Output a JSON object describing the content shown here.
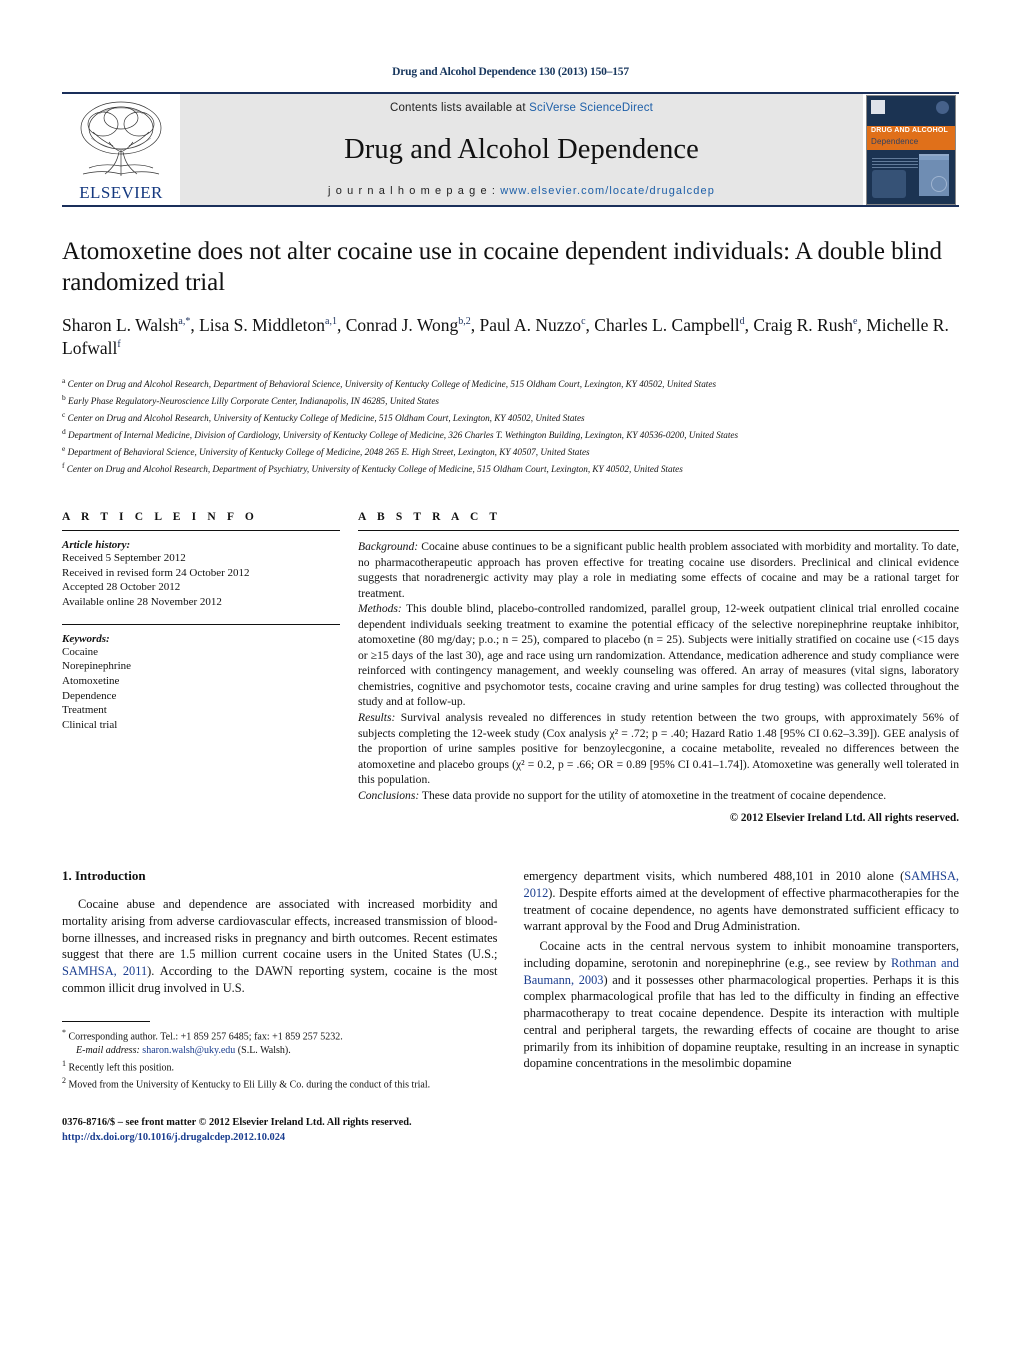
{
  "running_head": "Drug and Alcohol Dependence 130 (2013) 150–157",
  "masthead": {
    "contents_prefix": "Contents lists available at ",
    "contents_link": "SciVerse ScienceDirect",
    "journal_title": "Drug and Alcohol Dependence",
    "homepage_prefix": "j o u r n a l   h o m e p a g e :   ",
    "homepage_url": "www.elsevier.com/locate/drugalcdep",
    "publisher": "ELSEVIER",
    "cover": {
      "line1": "DRUG AND ALCOHOL",
      "line2": "Dependence"
    }
  },
  "article": {
    "title": "Atomoxetine does not alter cocaine use in cocaine dependent individuals: A double blind randomized trial",
    "authors_html": "Sharon L. Walsh<sup>a,*</sup>, Lisa S. Middleton<sup>a,1</sup>, Conrad J. Wong<sup>b,2</sup>, Paul A. Nuzzo<sup>c</sup>, Charles L. Campbell<sup>d</sup>, Craig R. Rush<sup>e</sup>, Michelle R. Lofwall<sup>f</sup>",
    "affiliations": [
      {
        "marker": "a",
        "text": "Center on Drug and Alcohol Research, Department of Behavioral Science, University of Kentucky College of Medicine, 515 Oldham Court, Lexington, KY 40502, United States"
      },
      {
        "marker": "b",
        "text": "Early Phase Regulatory-Neuroscience Lilly Corporate Center, Indianapolis, IN 46285, United States"
      },
      {
        "marker": "c",
        "text": "Center on Drug and Alcohol Research, University of Kentucky College of Medicine, 515 Oldham Court, Lexington, KY 40502, United States"
      },
      {
        "marker": "d",
        "text": "Department of Internal Medicine, Division of Cardiology, University of Kentucky College of Medicine, 326 Charles T. Wethington Building, Lexington, KY 40536-0200, United States"
      },
      {
        "marker": "e",
        "text": "Department of Behavioral Science, University of Kentucky College of Medicine, 2048 265 E. High Street, Lexington, KY 40507, United States"
      },
      {
        "marker": "f",
        "text": "Center on Drug and Alcohol Research, Department of Psychiatry, University of Kentucky College of Medicine, 515 Oldham Court, Lexington, KY 40502, United States"
      }
    ]
  },
  "article_info": {
    "heading": "A R T I C L E   I N F O",
    "history_label": "Article history:",
    "history": [
      "Received 5 September 2012",
      "Received in revised form 24 October 2012",
      "Accepted 28 October 2012",
      "Available online 28 November 2012"
    ],
    "keywords_label": "Keywords:",
    "keywords": [
      "Cocaine",
      "Norepinephrine",
      "Atomoxetine",
      "Dependence",
      "Treatment",
      "Clinical trial"
    ]
  },
  "abstract": {
    "heading": "A B S T R A C T",
    "sections": [
      {
        "label": "Background:",
        "text": " Cocaine abuse continues to be a significant public health problem associated with morbidity and mortality. To date, no pharmacotherapeutic approach has proven effective for treating cocaine use disorders. Preclinical and clinical evidence suggests that noradrenergic activity may play a role in mediating some effects of cocaine and may be a rational target for treatment."
      },
      {
        "label": "Methods:",
        "text": " This double blind, placebo-controlled randomized, parallel group, 12-week outpatient clinical trial enrolled cocaine dependent individuals seeking treatment to examine the potential efficacy of the selective norepinephrine reuptake inhibitor, atomoxetine (80 mg/day; p.o.; n = 25), compared to placebo (n = 25). Subjects were initially stratified on cocaine use (<15 days or ≥15 days of the last 30), age and race using urn randomization. Attendance, medication adherence and study compliance were reinforced with contingency management, and weekly counseling was offered. An array of measures (vital signs, laboratory chemistries, cognitive and psychomotor tests, cocaine craving and urine samples for drug testing) was collected throughout the study and at follow-up."
      },
      {
        "label": "Results:",
        "text": " Survival analysis revealed no differences in study retention between the two groups, with approximately 56% of subjects completing the 12-week study (Cox analysis χ² = .72; p = .40; Hazard Ratio 1.48 [95% CI 0.62–3.39]). GEE analysis of the proportion of urine samples positive for benzoylecgonine, a cocaine metabolite, revealed no differences between the atomoxetine and placebo groups (χ² = 0.2, p = .66; OR = 0.89 [95% CI 0.41–1.74]). Atomoxetine was generally well tolerated in this population."
      },
      {
        "label": "Conclusions:",
        "text": " These data provide no support for the utility of atomoxetine in the treatment of cocaine dependence."
      }
    ],
    "copyright": "© 2012 Elsevier Ireland Ltd. All rights reserved."
  },
  "body": {
    "section_number_title": "1.  Introduction",
    "left_paragraph_1": "Cocaine abuse and dependence are associated with increased morbidity and mortality arising from adverse cardiovascular effects, increased transmission of blood-borne illnesses, and increased risks in pregnancy and birth outcomes. Recent estimates suggest that there are 1.5 million current cocaine users in the United States (U.S.; ",
    "left_ref_1": "SAMHSA, 2011",
    "left_paragraph_1b": "). According to the DAWN reporting system, cocaine is the most common illicit drug involved in U.S.",
    "right_paragraph_1a": "emergency department visits, which numbered 488,101 in 2010 alone (",
    "right_ref_1": "SAMHSA, 2012",
    "right_paragraph_1b": "). Despite efforts aimed at the development of effective pharmacotherapies for the treatment of cocaine dependence, no agents have demonstrated sufficient efficacy to warrant approval by the Food and Drug Administration.",
    "right_paragraph_2a": "Cocaine acts in the central nervous system to inhibit monoamine transporters, including dopamine, serotonin and norepinephrine (e.g., see review by ",
    "right_ref_2": "Rothman and Baumann, 2003",
    "right_paragraph_2b": ") and it possesses other pharmacological properties. Perhaps it is this complex pharmacological profile that has led to the difficulty in finding an effective pharmacotherapy to treat cocaine dependence. Despite its interaction with multiple central and peripheral targets, the rewarding effects of cocaine are thought to arise primarily from its inhibition of dopamine reuptake, resulting in an increase in synaptic dopamine concentrations in the mesolimbic dopamine"
  },
  "footnotes": {
    "corresponding": "Corresponding author. Tel.: +1 859 257 6485; fax: +1 859 257 5232.",
    "email_label": "E-mail address:",
    "email": "sharon.walsh@uky.edu",
    "email_suffix": " (S.L. Walsh).",
    "note1_marker": "1",
    "note1": "Recently left this position.",
    "note2_marker": "2",
    "note2": "Moved from the University of Kentucky to Eli Lilly & Co. during the conduct of this trial."
  },
  "footer": {
    "issn": "0376-8716/$ – see front matter © 2012 Elsevier Ireland Ltd. All rights reserved.",
    "doi": "http://dx.doi.org/10.1016/j.drugalcdep.2012.10.024"
  },
  "colors": {
    "link": "#1a3d8f",
    "masthead_rule": "#1a2f5a",
    "masthead_bg": "#e6e6e6",
    "cover_orange": "#e0701a",
    "cover_blue": "#1b3352"
  }
}
